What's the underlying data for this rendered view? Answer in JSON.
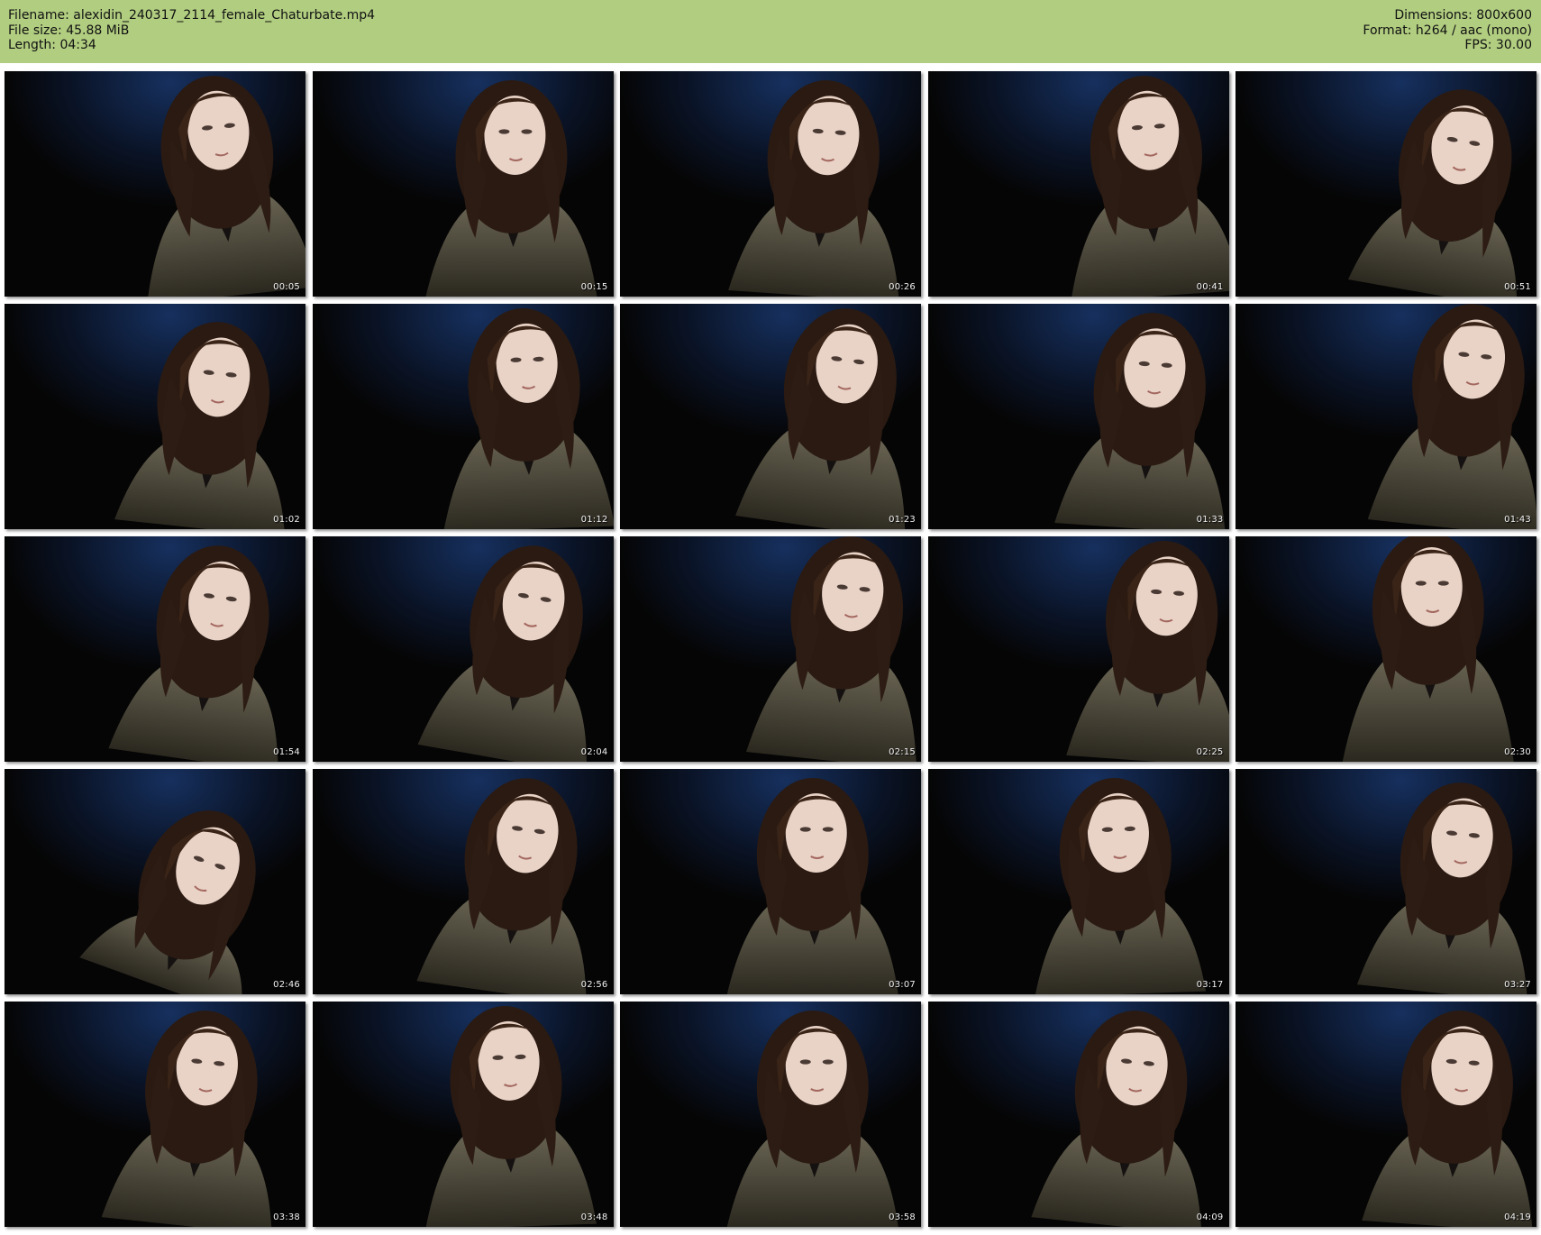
{
  "header": {
    "filename_line": "Filename: alexidin_240317_2114_female_Chaturbate.mp4",
    "filesize_line": "File size: 45.88 MiB",
    "length_line": "Length: 04:34",
    "dimensions_line": "Dimensions: 800x600",
    "format_line": "Format: h264 / aac (mono)",
    "fps_line": "FPS: 30.00"
  },
  "colors": {
    "header_background": "#b1cd80",
    "frame_background": "#050505",
    "timestamp_text": "#f2f2f2"
  },
  "thumbnails": [
    {
      "timestamp": "00:05"
    },
    {
      "timestamp": "00:15"
    },
    {
      "timestamp": "00:26"
    },
    {
      "timestamp": "00:41"
    },
    {
      "timestamp": "00:51"
    },
    {
      "timestamp": "01:02"
    },
    {
      "timestamp": "01:12"
    },
    {
      "timestamp": "01:23"
    },
    {
      "timestamp": "01:33"
    },
    {
      "timestamp": "01:43"
    },
    {
      "timestamp": "01:54"
    },
    {
      "timestamp": "02:04"
    },
    {
      "timestamp": "02:15"
    },
    {
      "timestamp": "02:25"
    },
    {
      "timestamp": "02:30"
    },
    {
      "timestamp": "02:46"
    },
    {
      "timestamp": "02:56"
    },
    {
      "timestamp": "03:07"
    },
    {
      "timestamp": "03:17"
    },
    {
      "timestamp": "03:27"
    },
    {
      "timestamp": "03:38"
    },
    {
      "timestamp": "03:48"
    },
    {
      "timestamp": "03:58"
    },
    {
      "timestamp": "04:09"
    },
    {
      "timestamp": "04:19"
    }
  ]
}
